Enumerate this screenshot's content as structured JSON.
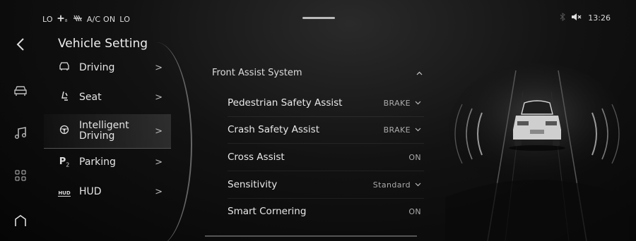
{
  "status": {
    "left": [
      "LO",
      "A/C ON",
      "LO"
    ],
    "time": "13:26"
  },
  "rail": {
    "icons": [
      "back-arrow-icon",
      "car-icon",
      "music-icon",
      "apps-grid-icon",
      "home-icon"
    ]
  },
  "title": "Vehicle Setting",
  "menu": {
    "items": [
      {
        "label": "Driving",
        "icon": "steering-car-icon"
      },
      {
        "label": "Seat",
        "icon": "seat-icon"
      },
      {
        "label": "Intelligent Driving",
        "icon": "steering-wheel-icon"
      },
      {
        "label": "Parking",
        "icon": "parking-icon"
      },
      {
        "label": "HUD",
        "icon": "hud-icon"
      }
    ],
    "hud_badge": "HUD",
    "parking_badge": "P"
  },
  "panel": {
    "section": "Front Assist System",
    "rows": [
      {
        "label": "Pedestrian Safety Assist",
        "value": "BRAKE"
      },
      {
        "label": "Crash Safety Assist",
        "value": "BRAKE"
      },
      {
        "label": "Cross Assist",
        "value": "ON"
      },
      {
        "label": "Sensitivity",
        "value": "Standard"
      },
      {
        "label": "Smart Cornering",
        "value": "ON"
      }
    ]
  }
}
